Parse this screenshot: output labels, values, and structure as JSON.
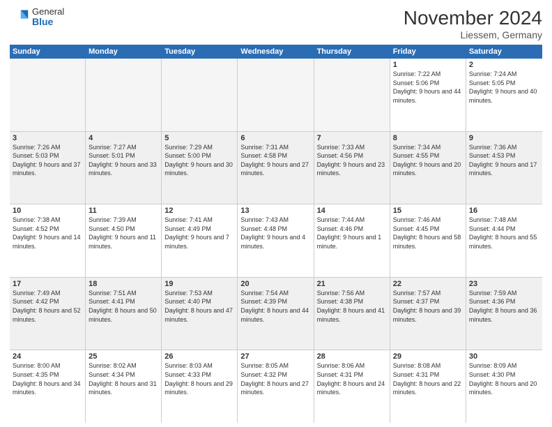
{
  "logo": {
    "general": "General",
    "blue": "Blue"
  },
  "header": {
    "title": "November 2024",
    "location": "Liessem, Germany"
  },
  "weekdays": [
    "Sunday",
    "Monday",
    "Tuesday",
    "Wednesday",
    "Thursday",
    "Friday",
    "Saturday"
  ],
  "rows": [
    [
      {
        "day": "",
        "empty": true
      },
      {
        "day": "",
        "empty": true
      },
      {
        "day": "",
        "empty": true
      },
      {
        "day": "",
        "empty": true
      },
      {
        "day": "",
        "empty": true
      },
      {
        "day": "1",
        "sunrise": "7:22 AM",
        "sunset": "5:06 PM",
        "daylight": "9 hours and 44 minutes."
      },
      {
        "day": "2",
        "sunrise": "7:24 AM",
        "sunset": "5:05 PM",
        "daylight": "9 hours and 40 minutes."
      }
    ],
    [
      {
        "day": "3",
        "sunrise": "7:26 AM",
        "sunset": "5:03 PM",
        "daylight": "9 hours and 37 minutes."
      },
      {
        "day": "4",
        "sunrise": "7:27 AM",
        "sunset": "5:01 PM",
        "daylight": "9 hours and 33 minutes."
      },
      {
        "day": "5",
        "sunrise": "7:29 AM",
        "sunset": "5:00 PM",
        "daylight": "9 hours and 30 minutes."
      },
      {
        "day": "6",
        "sunrise": "7:31 AM",
        "sunset": "4:58 PM",
        "daylight": "9 hours and 27 minutes."
      },
      {
        "day": "7",
        "sunrise": "7:33 AM",
        "sunset": "4:56 PM",
        "daylight": "9 hours and 23 minutes."
      },
      {
        "day": "8",
        "sunrise": "7:34 AM",
        "sunset": "4:55 PM",
        "daylight": "9 hours and 20 minutes."
      },
      {
        "day": "9",
        "sunrise": "7:36 AM",
        "sunset": "4:53 PM",
        "daylight": "9 hours and 17 minutes."
      }
    ],
    [
      {
        "day": "10",
        "sunrise": "7:38 AM",
        "sunset": "4:52 PM",
        "daylight": "9 hours and 14 minutes."
      },
      {
        "day": "11",
        "sunrise": "7:39 AM",
        "sunset": "4:50 PM",
        "daylight": "9 hours and 11 minutes."
      },
      {
        "day": "12",
        "sunrise": "7:41 AM",
        "sunset": "4:49 PM",
        "daylight": "9 hours and 7 minutes."
      },
      {
        "day": "13",
        "sunrise": "7:43 AM",
        "sunset": "4:48 PM",
        "daylight": "9 hours and 4 minutes."
      },
      {
        "day": "14",
        "sunrise": "7:44 AM",
        "sunset": "4:46 PM",
        "daylight": "9 hours and 1 minute."
      },
      {
        "day": "15",
        "sunrise": "7:46 AM",
        "sunset": "4:45 PM",
        "daylight": "8 hours and 58 minutes."
      },
      {
        "day": "16",
        "sunrise": "7:48 AM",
        "sunset": "4:44 PM",
        "daylight": "8 hours and 55 minutes."
      }
    ],
    [
      {
        "day": "17",
        "sunrise": "7:49 AM",
        "sunset": "4:42 PM",
        "daylight": "8 hours and 52 minutes."
      },
      {
        "day": "18",
        "sunrise": "7:51 AM",
        "sunset": "4:41 PM",
        "daylight": "8 hours and 50 minutes."
      },
      {
        "day": "19",
        "sunrise": "7:53 AM",
        "sunset": "4:40 PM",
        "daylight": "8 hours and 47 minutes."
      },
      {
        "day": "20",
        "sunrise": "7:54 AM",
        "sunset": "4:39 PM",
        "daylight": "8 hours and 44 minutes."
      },
      {
        "day": "21",
        "sunrise": "7:56 AM",
        "sunset": "4:38 PM",
        "daylight": "8 hours and 41 minutes."
      },
      {
        "day": "22",
        "sunrise": "7:57 AM",
        "sunset": "4:37 PM",
        "daylight": "8 hours and 39 minutes."
      },
      {
        "day": "23",
        "sunrise": "7:59 AM",
        "sunset": "4:36 PM",
        "daylight": "8 hours and 36 minutes."
      }
    ],
    [
      {
        "day": "24",
        "sunrise": "8:00 AM",
        "sunset": "4:35 PM",
        "daylight": "8 hours and 34 minutes."
      },
      {
        "day": "25",
        "sunrise": "8:02 AM",
        "sunset": "4:34 PM",
        "daylight": "8 hours and 31 minutes."
      },
      {
        "day": "26",
        "sunrise": "8:03 AM",
        "sunset": "4:33 PM",
        "daylight": "8 hours and 29 minutes."
      },
      {
        "day": "27",
        "sunrise": "8:05 AM",
        "sunset": "4:32 PM",
        "daylight": "8 hours and 27 minutes."
      },
      {
        "day": "28",
        "sunrise": "8:06 AM",
        "sunset": "4:31 PM",
        "daylight": "8 hours and 24 minutes."
      },
      {
        "day": "29",
        "sunrise": "8:08 AM",
        "sunset": "4:31 PM",
        "daylight": "8 hours and 22 minutes."
      },
      {
        "day": "30",
        "sunrise": "8:09 AM",
        "sunset": "4:30 PM",
        "daylight": "8 hours and 20 minutes."
      }
    ]
  ]
}
